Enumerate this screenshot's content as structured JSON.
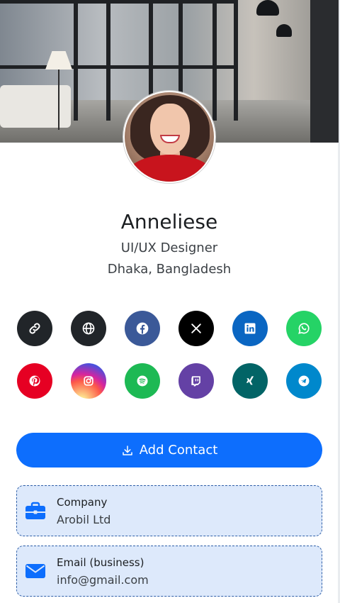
{
  "profile": {
    "name": "Anneliese",
    "title": "UI/UX Designer",
    "location": "Dhaka, Bangladesh"
  },
  "social_links": [
    {
      "name": "link",
      "color": "#212529"
    },
    {
      "name": "website",
      "color": "#212529"
    },
    {
      "name": "facebook",
      "color": "#3b5998"
    },
    {
      "name": "x",
      "color": "#000000"
    },
    {
      "name": "linkedin",
      "color": "#0a66c2"
    },
    {
      "name": "whatsapp",
      "color": "#25d366"
    },
    {
      "name": "pinterest",
      "color": "#e60023"
    },
    {
      "name": "instagram",
      "color": "#d6249f"
    },
    {
      "name": "spotify",
      "color": "#1db954"
    },
    {
      "name": "twitch",
      "color": "#6441a5"
    },
    {
      "name": "xing",
      "color": "#026466"
    },
    {
      "name": "telegram",
      "color": "#0088cc"
    }
  ],
  "actions": {
    "add_contact_label": "Add Contact",
    "add_contact_icon": "download-icon"
  },
  "info_cards": [
    {
      "label": "Company",
      "value": "Arobil Ltd",
      "icon": "briefcase-icon"
    },
    {
      "label": "Email (business)",
      "value": "info@gmail.com",
      "icon": "envelope-icon"
    }
  ],
  "colors": {
    "primary": "#0d6efd",
    "card_background": "#dde9fb",
    "card_border": "#2f5fa8"
  }
}
